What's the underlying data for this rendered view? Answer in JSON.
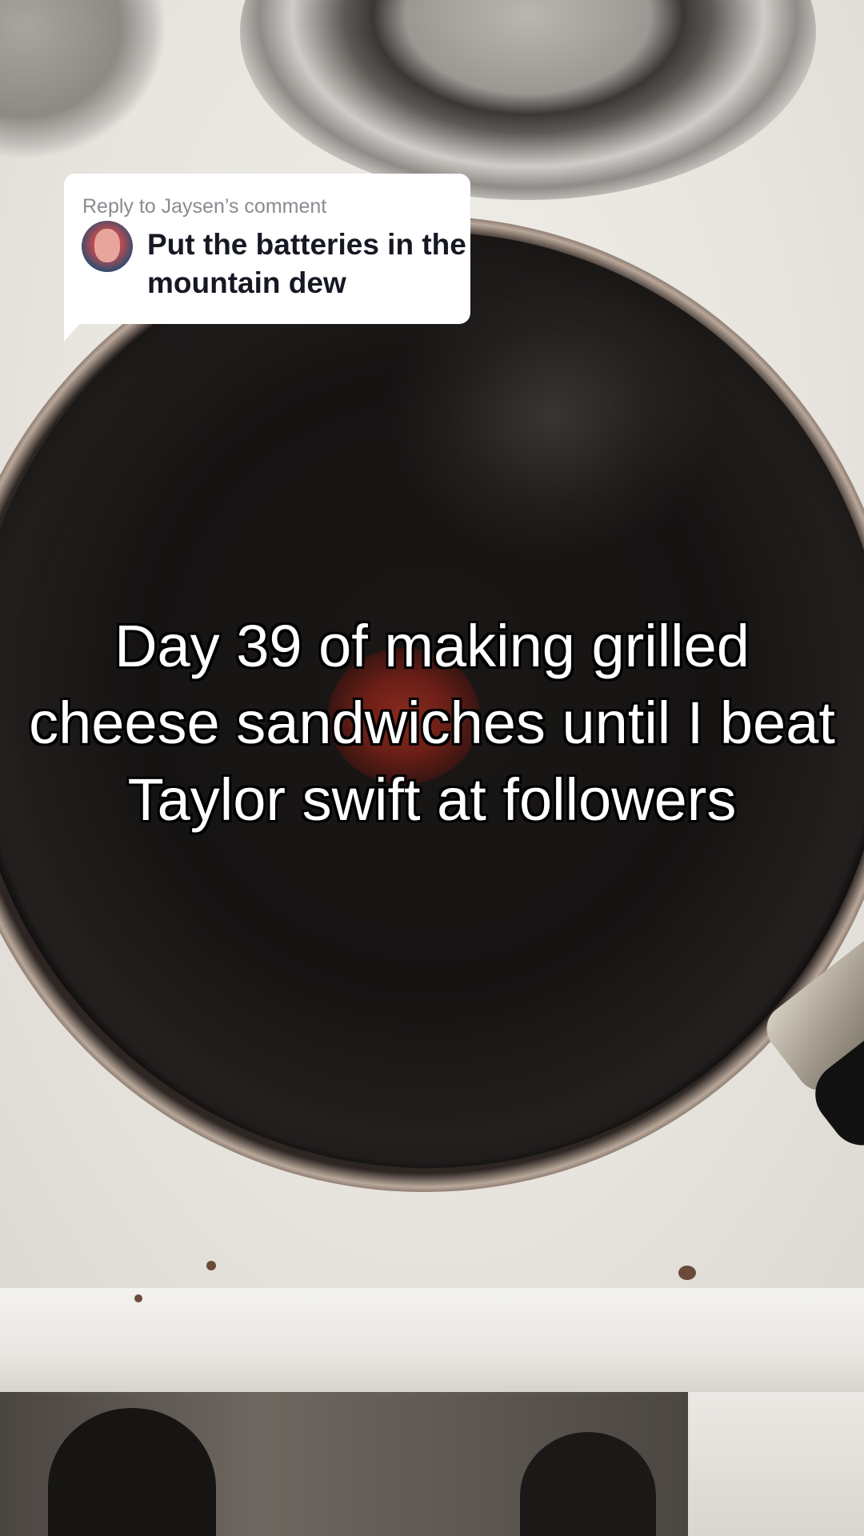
{
  "reply": {
    "header": "Reply to Jaysen’s comment",
    "text": "Put the batteries in the mountain dew"
  },
  "caption": {
    "text": "Day 39 of making grilled cheese sandwiches until I beat Taylor swift at followers"
  }
}
